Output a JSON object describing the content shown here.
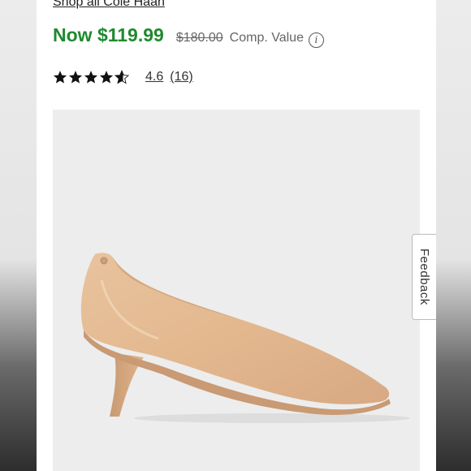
{
  "brand": {
    "link_text": "Shop all Cole Haan"
  },
  "pricing": {
    "now_price": "Now $119.99",
    "original_price": "$180.00",
    "comp_label": "Comp. Value",
    "info_icon": "info-icon"
  },
  "rating": {
    "value": 4.6,
    "value_text": "4.6",
    "reviews_text": "(16)",
    "star_color": "#111111"
  },
  "product_image": {
    "subject": "nude-pump-shoe"
  },
  "feedback": {
    "label": "Feedback"
  },
  "colors": {
    "price_green": "#1f8a2e",
    "image_bg": "#ededed"
  }
}
